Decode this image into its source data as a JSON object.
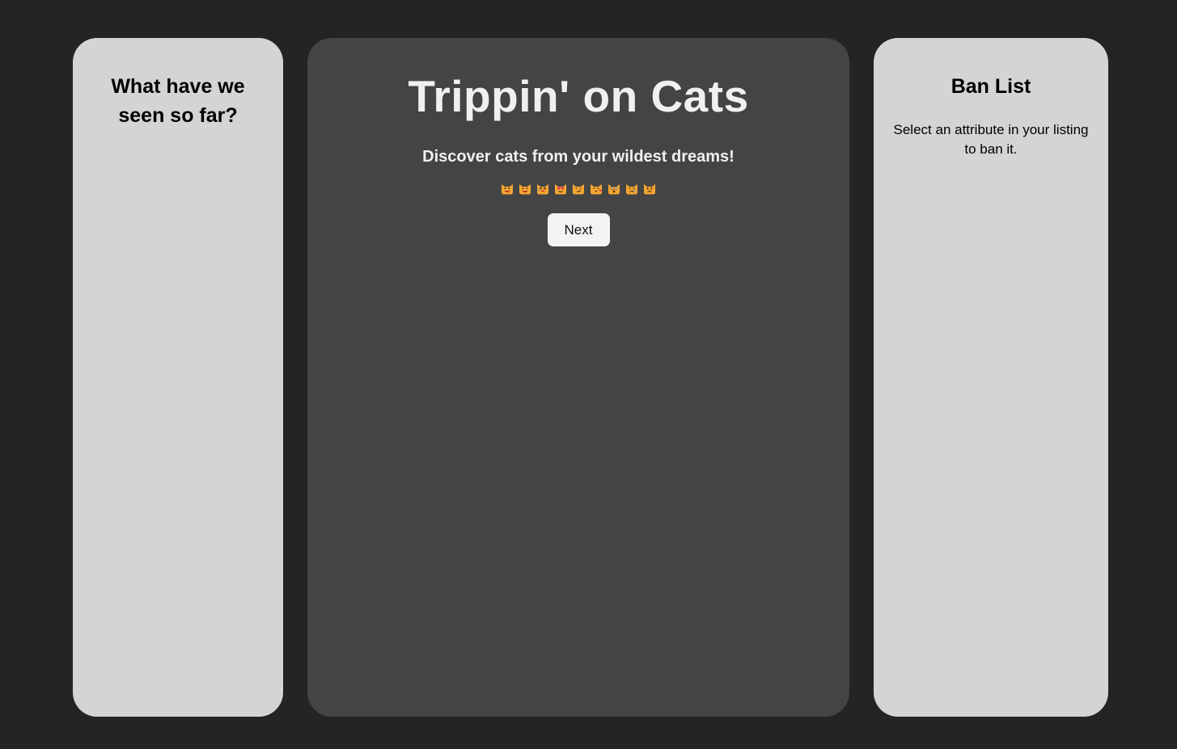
{
  "history": {
    "title": "What have we seen so far?"
  },
  "main": {
    "title": "Trippin' on Cats",
    "subtitle": "Discover cats from your wildest dreams!",
    "emojis": [
      "smiley-cat-icon",
      "smile-cat-icon",
      "laughing-cat-icon",
      "heart-eyes-cat-icon",
      "smirk-cat-icon",
      "kissing-cat-icon",
      "scream-cat-icon",
      "crying-cat-icon",
      "pouting-cat-icon"
    ],
    "next_label": "Next"
  },
  "ban_list": {
    "title": "Ban List",
    "description": "Select an attribute in your listing to ban it."
  },
  "colors": {
    "background": "#242424",
    "side_panel": "#d4d4d4",
    "main_panel": "#444444",
    "cat_face": "#f4a632"
  }
}
